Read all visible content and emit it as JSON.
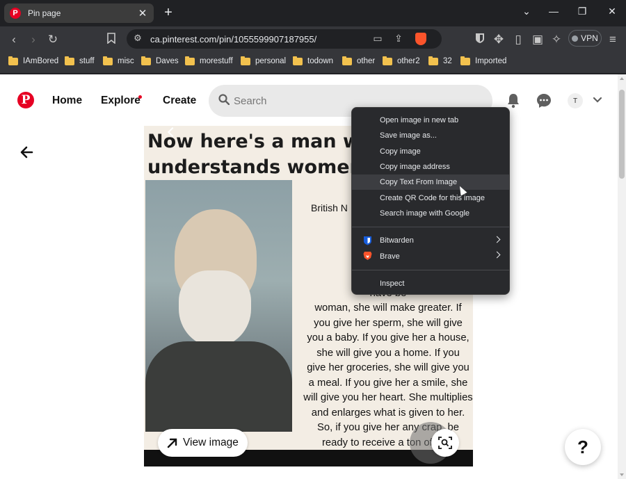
{
  "tab": {
    "title": "Pin page",
    "favicon": "P"
  },
  "address": {
    "url": "ca.pinterest.com/pin/1055599907187955/"
  },
  "toolbar": {
    "vpn_label": "VPN"
  },
  "bookmarks": [
    "IAmBored",
    "stuff",
    "misc",
    "Daves",
    "morestuff",
    "personal",
    "todown",
    "other",
    "other2",
    "32",
    "Imported"
  ],
  "header": {
    "nav": {
      "home": "Home",
      "explore": "Explore",
      "create": "Create"
    },
    "search_placeholder": "Search",
    "avatar_initial": "T"
  },
  "pin": {
    "headline": "Now here's a man w\nunderstands women",
    "subtitle": "British N",
    "quote": "I think\npretend\nThey are\nhave be\nwoman, she will make greater. If\nyou give her sperm, she will give\nyou a baby. If you give her a house,\nshe will give you a home. If you\ngive her groceries, she will give you\na meal. If you give her a smile, she\nwill give you her heart. She multiplies\nand enlarges what is given to her.\nSo, if you give her any crap, be\nready to receive a ton of shit!",
    "view_image_label": "View image",
    "help_label": "?"
  },
  "context_menu": {
    "items": [
      {
        "label": "Open image in new tab"
      },
      {
        "label": "Save image as..."
      },
      {
        "label": "Copy image"
      },
      {
        "label": "Copy image address"
      },
      {
        "label": "Copy Text From Image",
        "highlighted": true
      },
      {
        "label": "Create QR Code for this image"
      },
      {
        "label": "Search image with Google"
      },
      {
        "label": "Bitwarden",
        "icon": "bitwarden-icon",
        "submenu": true
      },
      {
        "label": "Brave",
        "icon": "brave-icon",
        "submenu": true
      },
      {
        "label": "Inspect"
      }
    ]
  }
}
